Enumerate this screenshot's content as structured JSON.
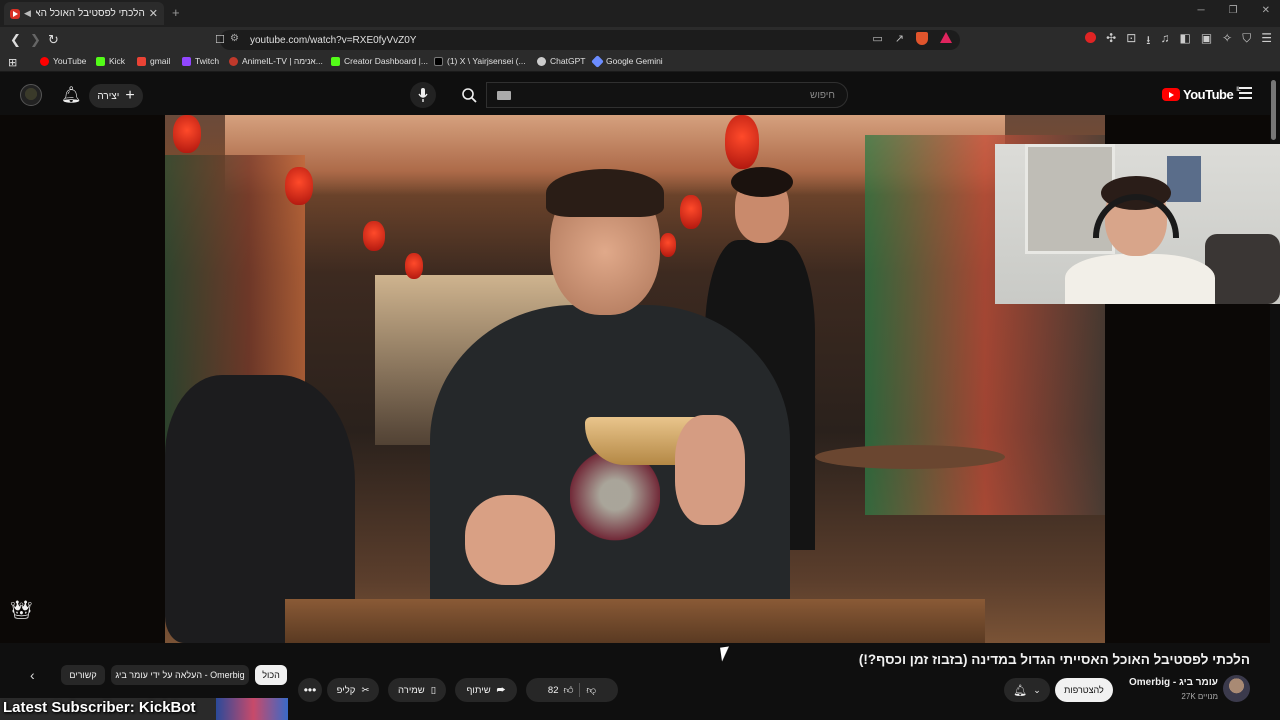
{
  "browser": {
    "tab_title": "הלכתי לפסטיבל האוכל האסיי",
    "tab_close": "✕",
    "new_tab": "+",
    "url": "youtube.com/watch?v=RXE0fyVvZ0Y",
    "bookmarks": [
      {
        "label": "YouTube",
        "color": "#ff0000"
      },
      {
        "label": "Kick",
        "color": "#53fc18"
      },
      {
        "label": "gmail",
        "color": "#ea4335"
      },
      {
        "label": "Twitch",
        "color": "#9146ff"
      },
      {
        "label": "AnimeIL-TV | אנימה...",
        "color": "#c0392b"
      },
      {
        "label": "Creator Dashboard |...",
        "color": "#53fc18"
      },
      {
        "label": "(1) X \\ Yairjsensei (...",
        "color": "#000000"
      },
      {
        "label": "ChatGPT",
        "color": "#cccccc"
      },
      {
        "label": "Google Gemini",
        "color": "#6b8cff"
      }
    ]
  },
  "youtube": {
    "logo_text": "YouTube",
    "logo_sup": "IL",
    "create_label": "יצירה",
    "search_placeholder": "חיפוש"
  },
  "video": {
    "title": "הלכתי לפסטיבל האוכל האסייתי הגדול במדינה (בזבוז זמן וכסף?!)",
    "channel_name": "עומר ביג - Omerbig",
    "subscribers": "27K מנויים",
    "subscribe_label": "להצטרפות",
    "like_count": "82",
    "share_label": "שיתוף",
    "save_label": "שמירה",
    "clip_label": "קליפ",
    "more_label": "•••"
  },
  "chips": {
    "all": "הכול",
    "uploaded_by": "העלאה על ידי עומר ביג - Omerbig",
    "related": "קשורים"
  },
  "overlay": {
    "latest_subscriber": "Latest Subscriber: KickBot"
  },
  "colors": {
    "accent": "#ff0000",
    "background": "#0f0f0f"
  }
}
